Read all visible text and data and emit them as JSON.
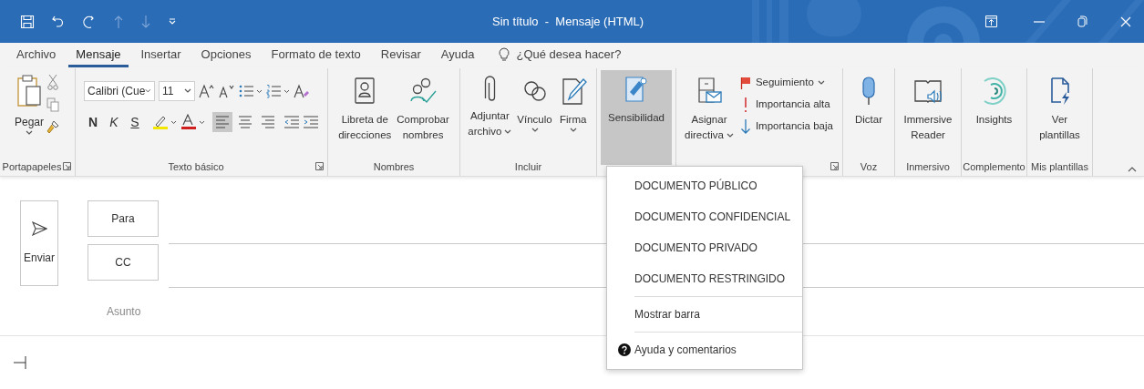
{
  "title_bar": {
    "title": "Sin título  -  Mensaje (HTML)"
  },
  "tabs": [
    {
      "label": "Archivo",
      "selected": false
    },
    {
      "label": "Mensaje",
      "selected": true
    },
    {
      "label": "Insertar",
      "selected": false
    },
    {
      "label": "Opciones",
      "selected": false
    },
    {
      "label": "Formato de texto",
      "selected": false
    },
    {
      "label": "Revisar",
      "selected": false
    },
    {
      "label": "Ayuda",
      "selected": false
    }
  ],
  "tell_me": {
    "placeholder": "¿Qué desea hacer?"
  },
  "ribbon": {
    "clipboard": {
      "label": "Portapapeles",
      "paste": "Pegar"
    },
    "basic_text": {
      "label": "Texto básico",
      "font": "Calibri (Cue",
      "size": "11",
      "styles": [
        "N",
        "K",
        "S"
      ],
      "alignment": [
        {
          "selected": true
        },
        {
          "selected": false
        },
        {
          "selected": false
        }
      ]
    },
    "names": {
      "label": "Nombres",
      "buttons": [
        {
          "lines": [
            "Libreta de",
            "direcciones"
          ],
          "dropdown": false
        },
        {
          "lines": [
            "Comprobar",
            "nombres"
          ],
          "dropdown": false
        }
      ]
    },
    "include": {
      "label": "Incluir",
      "buttons": [
        {
          "lines": [
            "Adjuntar",
            "archivo"
          ],
          "dropdown": true
        },
        {
          "lines": [
            "Vínculo"
          ],
          "dropdown": true
        },
        {
          "lines": [
            "Firma"
          ],
          "dropdown": true
        }
      ]
    },
    "sensitivity": {
      "lines": [
        "Sensibilidad"
      ],
      "expanded": true
    },
    "tags": {
      "assign": {
        "lines": [
          "Asignar",
          "directiva"
        ],
        "dropdown": true
      },
      "flags": [
        {
          "label": "Seguimiento",
          "dropdown": true
        },
        {
          "label": "Importancia alta",
          "dropdown": false
        },
        {
          "label": "Importancia baja",
          "dropdown": false
        }
      ]
    },
    "voice": {
      "label": "Voz",
      "buttons": [
        {
          "lines": [
            "Dictar"
          ],
          "dropdown": false
        }
      ]
    },
    "immersive": {
      "label": "Inmersivo",
      "buttons": [
        {
          "lines": [
            "Immersive",
            "Reader"
          ],
          "dropdown": false
        }
      ]
    },
    "addin": {
      "label": "Complemento",
      "buttons": [
        {
          "lines": [
            "Insights"
          ],
          "dropdown": false
        }
      ]
    },
    "templates": {
      "label": "Mis plantillas",
      "buttons": [
        {
          "lines": [
            "Ver",
            "plantillas"
          ],
          "dropdown": false
        }
      ]
    }
  },
  "sensitivity_menu": [
    {
      "kind": "label",
      "label": "DOCUMENTO PÚBLICO"
    },
    {
      "kind": "label",
      "label": "DOCUMENTO CONFIDENCIAL"
    },
    {
      "kind": "label",
      "label": "DOCUMENTO PRIVADO"
    },
    {
      "kind": "label",
      "label": "DOCUMENTO RESTRINGIDO"
    },
    {
      "kind": "command",
      "label": "Mostrar barra"
    },
    {
      "kind": "help",
      "label": "Ayuda y comentarios"
    }
  ],
  "compose": {
    "send": "Enviar",
    "recipients": [
      {
        "label": "Para"
      },
      {
        "label": "CC"
      }
    ],
    "subject": {
      "placeholder": "Asunto"
    }
  }
}
